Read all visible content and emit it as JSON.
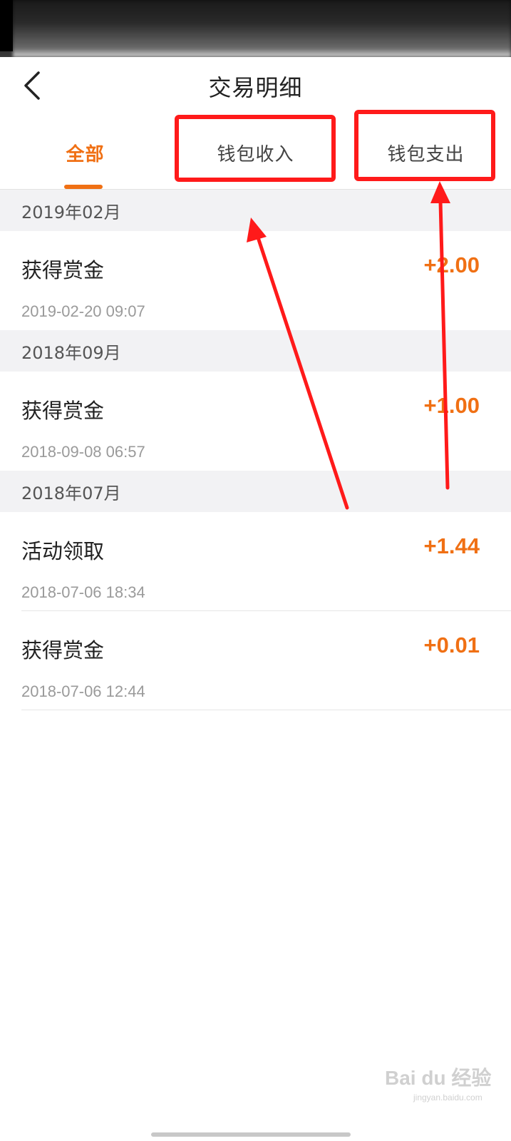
{
  "header": {
    "title": "交易明细"
  },
  "tabs": [
    {
      "label": "全部",
      "active": true
    },
    {
      "label": "钱包收入",
      "active": false
    },
    {
      "label": "钱包支出",
      "active": false
    }
  ],
  "groups": [
    {
      "month": "2019年02月",
      "transactions": [
        {
          "title": "获得赏金",
          "time": "2019-02-20 09:07",
          "amount": "+2.00"
        }
      ]
    },
    {
      "month": "2018年09月",
      "transactions": [
        {
          "title": "获得赏金",
          "time": "2018-09-08 06:57",
          "amount": "+1.00"
        }
      ]
    },
    {
      "month": "2018年07月",
      "transactions": [
        {
          "title": "活动领取",
          "time": "2018-07-06 18:34",
          "amount": "+1.44"
        },
        {
          "title": "获得赏金",
          "time": "2018-07-06 12:44",
          "amount": "+0.01"
        }
      ]
    }
  ],
  "colors": {
    "accent": "#f07014",
    "annotation": "#ff1a1a",
    "section_bg": "#f2f2f4"
  },
  "watermark": {
    "brand": "Bai du 经验",
    "url": "jingyan.baidu.com"
  }
}
